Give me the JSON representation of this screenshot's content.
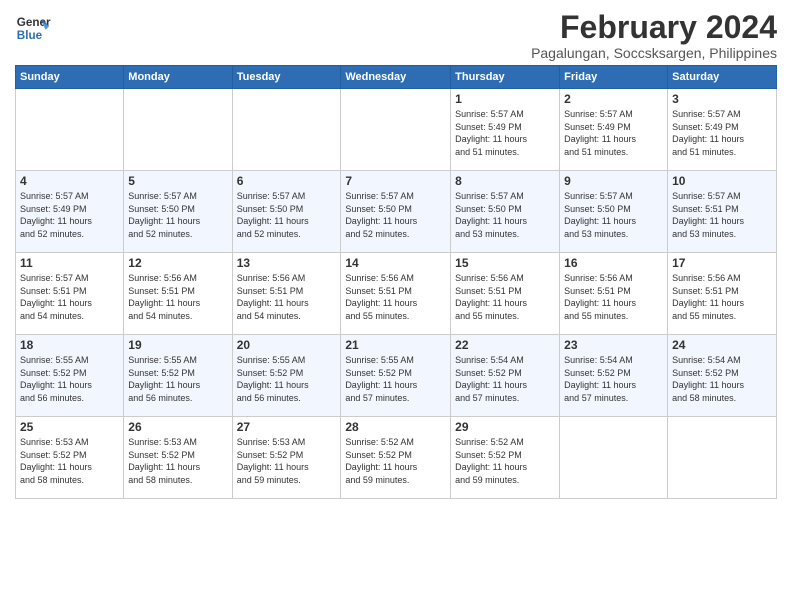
{
  "logo": {
    "line1": "General",
    "line2": "Blue"
  },
  "title": "February 2024",
  "subtitle": "Pagalungan, Soccsksargen, Philippines",
  "headers": [
    "Sunday",
    "Monday",
    "Tuesday",
    "Wednesday",
    "Thursday",
    "Friday",
    "Saturday"
  ],
  "weeks": [
    [
      {
        "day": "",
        "info": ""
      },
      {
        "day": "",
        "info": ""
      },
      {
        "day": "",
        "info": ""
      },
      {
        "day": "",
        "info": ""
      },
      {
        "day": "1",
        "info": "Sunrise: 5:57 AM\nSunset: 5:49 PM\nDaylight: 11 hours\nand 51 minutes."
      },
      {
        "day": "2",
        "info": "Sunrise: 5:57 AM\nSunset: 5:49 PM\nDaylight: 11 hours\nand 51 minutes."
      },
      {
        "day": "3",
        "info": "Sunrise: 5:57 AM\nSunset: 5:49 PM\nDaylight: 11 hours\nand 51 minutes."
      }
    ],
    [
      {
        "day": "4",
        "info": "Sunrise: 5:57 AM\nSunset: 5:49 PM\nDaylight: 11 hours\nand 52 minutes."
      },
      {
        "day": "5",
        "info": "Sunrise: 5:57 AM\nSunset: 5:50 PM\nDaylight: 11 hours\nand 52 minutes."
      },
      {
        "day": "6",
        "info": "Sunrise: 5:57 AM\nSunset: 5:50 PM\nDaylight: 11 hours\nand 52 minutes."
      },
      {
        "day": "7",
        "info": "Sunrise: 5:57 AM\nSunset: 5:50 PM\nDaylight: 11 hours\nand 52 minutes."
      },
      {
        "day": "8",
        "info": "Sunrise: 5:57 AM\nSunset: 5:50 PM\nDaylight: 11 hours\nand 53 minutes."
      },
      {
        "day": "9",
        "info": "Sunrise: 5:57 AM\nSunset: 5:50 PM\nDaylight: 11 hours\nand 53 minutes."
      },
      {
        "day": "10",
        "info": "Sunrise: 5:57 AM\nSunset: 5:51 PM\nDaylight: 11 hours\nand 53 minutes."
      }
    ],
    [
      {
        "day": "11",
        "info": "Sunrise: 5:57 AM\nSunset: 5:51 PM\nDaylight: 11 hours\nand 54 minutes."
      },
      {
        "day": "12",
        "info": "Sunrise: 5:56 AM\nSunset: 5:51 PM\nDaylight: 11 hours\nand 54 minutes."
      },
      {
        "day": "13",
        "info": "Sunrise: 5:56 AM\nSunset: 5:51 PM\nDaylight: 11 hours\nand 54 minutes."
      },
      {
        "day": "14",
        "info": "Sunrise: 5:56 AM\nSunset: 5:51 PM\nDaylight: 11 hours\nand 55 minutes."
      },
      {
        "day": "15",
        "info": "Sunrise: 5:56 AM\nSunset: 5:51 PM\nDaylight: 11 hours\nand 55 minutes."
      },
      {
        "day": "16",
        "info": "Sunrise: 5:56 AM\nSunset: 5:51 PM\nDaylight: 11 hours\nand 55 minutes."
      },
      {
        "day": "17",
        "info": "Sunrise: 5:56 AM\nSunset: 5:51 PM\nDaylight: 11 hours\nand 55 minutes."
      }
    ],
    [
      {
        "day": "18",
        "info": "Sunrise: 5:55 AM\nSunset: 5:52 PM\nDaylight: 11 hours\nand 56 minutes."
      },
      {
        "day": "19",
        "info": "Sunrise: 5:55 AM\nSunset: 5:52 PM\nDaylight: 11 hours\nand 56 minutes."
      },
      {
        "day": "20",
        "info": "Sunrise: 5:55 AM\nSunset: 5:52 PM\nDaylight: 11 hours\nand 56 minutes."
      },
      {
        "day": "21",
        "info": "Sunrise: 5:55 AM\nSunset: 5:52 PM\nDaylight: 11 hours\nand 57 minutes."
      },
      {
        "day": "22",
        "info": "Sunrise: 5:54 AM\nSunset: 5:52 PM\nDaylight: 11 hours\nand 57 minutes."
      },
      {
        "day": "23",
        "info": "Sunrise: 5:54 AM\nSunset: 5:52 PM\nDaylight: 11 hours\nand 57 minutes."
      },
      {
        "day": "24",
        "info": "Sunrise: 5:54 AM\nSunset: 5:52 PM\nDaylight: 11 hours\nand 58 minutes."
      }
    ],
    [
      {
        "day": "25",
        "info": "Sunrise: 5:53 AM\nSunset: 5:52 PM\nDaylight: 11 hours\nand 58 minutes."
      },
      {
        "day": "26",
        "info": "Sunrise: 5:53 AM\nSunset: 5:52 PM\nDaylight: 11 hours\nand 58 minutes."
      },
      {
        "day": "27",
        "info": "Sunrise: 5:53 AM\nSunset: 5:52 PM\nDaylight: 11 hours\nand 59 minutes."
      },
      {
        "day": "28",
        "info": "Sunrise: 5:52 AM\nSunset: 5:52 PM\nDaylight: 11 hours\nand 59 minutes."
      },
      {
        "day": "29",
        "info": "Sunrise: 5:52 AM\nSunset: 5:52 PM\nDaylight: 11 hours\nand 59 minutes."
      },
      {
        "day": "",
        "info": ""
      },
      {
        "day": "",
        "info": ""
      }
    ]
  ]
}
